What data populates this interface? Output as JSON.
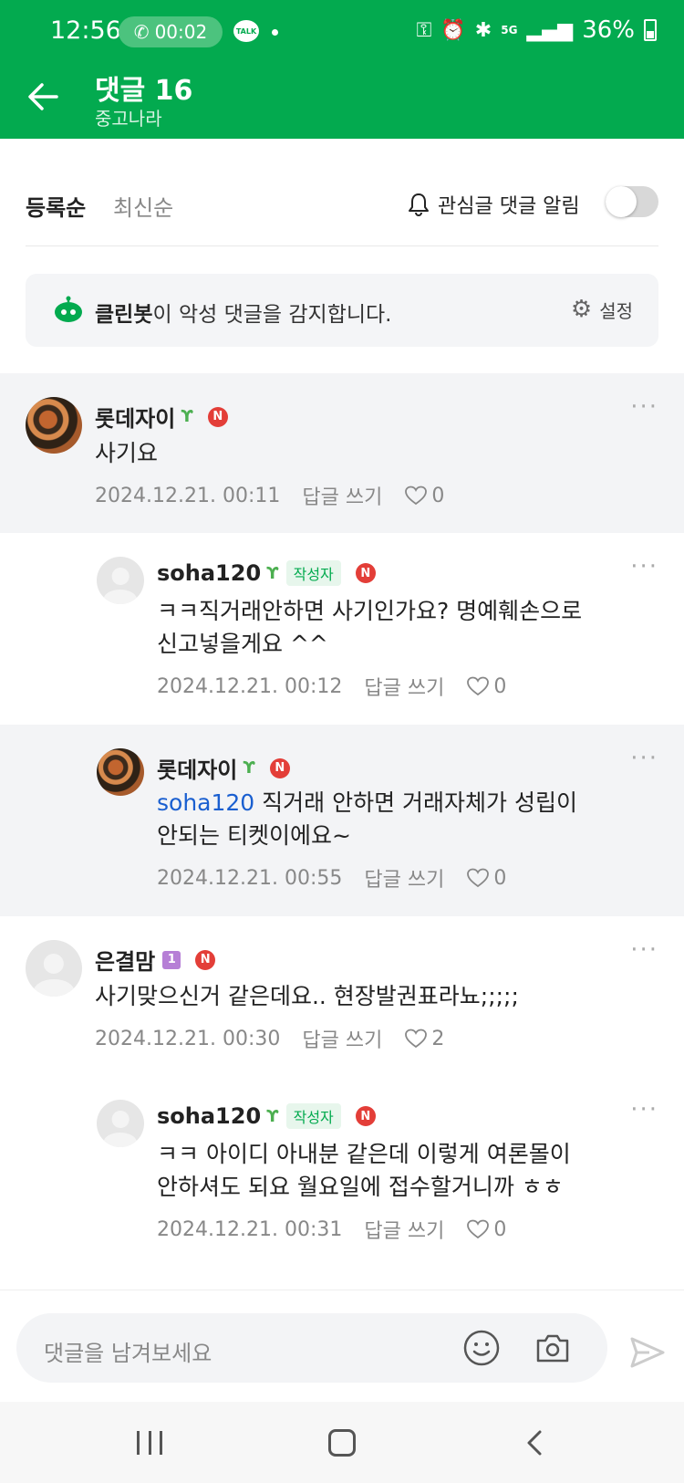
{
  "status": {
    "time": "12:56",
    "call_timer": "00:02",
    "talk_label": "TALK",
    "battery": "36%",
    "network": "5G"
  },
  "appbar": {
    "title": "댓글 16",
    "subtitle": "중고나라"
  },
  "sort": {
    "active": "등록순",
    "inactive": "최신순",
    "notify_label": "관심글 댓글 알림",
    "notify_on": false
  },
  "cleanbot": {
    "name": "클린봇",
    "message": "이 악성 댓글을 감지합니다.",
    "settings_label": "설정"
  },
  "labels": {
    "reply": "답글 쓰기",
    "author_badge": "작성자",
    "n_badge": "N",
    "grade_badge": "1",
    "more": "···"
  },
  "comments": [
    {
      "nickname": "롯데자이",
      "text": "사기요",
      "date": "2024.12.21. 00:11",
      "likes": "0"
    },
    {
      "nickname": "soha120",
      "text_line1": "ㅋㅋ직거래안하면 사기인가요? 명예훼손으로",
      "text_line2": "신고넣을게요 ^^",
      "date": "2024.12.21. 00:12",
      "likes": "0"
    },
    {
      "nickname": "롯데자이",
      "mention": "soha120",
      "text_line1": " 직거래 안하면 거래자체가 성립이",
      "text_line2": "안되는 티켓이에요~",
      "date": "2024.12.21. 00:55",
      "likes": "0"
    },
    {
      "nickname": "은결맘",
      "text": "사기맞으신거 같은데요.. 현장발권표라뇨;;;;;",
      "date": "2024.12.21. 00:30",
      "likes": "2"
    },
    {
      "nickname": "soha120",
      "text_line1": "ㅋㅋ 아이디 아내분 같은데 이렇게 여론몰이",
      "text_line2": "안하셔도 되요 월요일에 접수할거니까 ㅎㅎ",
      "date": "2024.12.21. 00:31",
      "likes": "0"
    }
  ],
  "input": {
    "placeholder": "댓글을 남겨보세요"
  },
  "colors": {
    "brand_green": "#03AA4F",
    "mention_blue": "#1a5fd0",
    "n_badge_red": "#e33e38"
  }
}
